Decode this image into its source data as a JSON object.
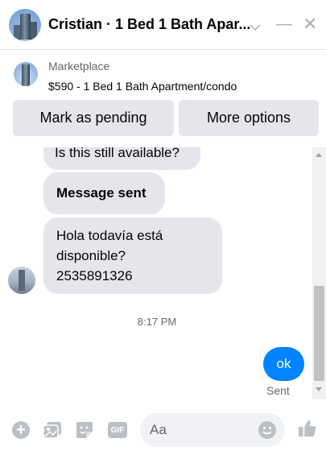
{
  "header": {
    "title": "Cristian · 1 Bed 1 Bath Apar...",
    "chevron_icon": "chevron-down-icon",
    "minimize_label": "—",
    "close_label": "✕"
  },
  "marketplace": {
    "label": "Marketplace",
    "item": "$590 - 1 Bed 1 Bath Apartment/condo",
    "mark_pending_label": "Mark as pending",
    "more_options_label": "More options"
  },
  "messages": {
    "m1": "Is this still available?",
    "m2": "Message sent",
    "m3_line1": "Hola todavía está",
    "m3_line2": "disponible?",
    "m3_line3": "2535891326",
    "timestamp": "8:17 PM",
    "sent_text": "ok",
    "sent_status": "Sent"
  },
  "composer": {
    "placeholder": "Aa",
    "gif_label": "GIF",
    "plus_label": "+",
    "icons": [
      "plus-icon",
      "photo-icon",
      "sticker-icon",
      "gif-icon",
      "emoji-icon",
      "like-icon"
    ]
  },
  "colors": {
    "accent": "#0084ff",
    "bubble_gray": "#e4e6eb",
    "icon_gray": "#bcc0c4"
  }
}
